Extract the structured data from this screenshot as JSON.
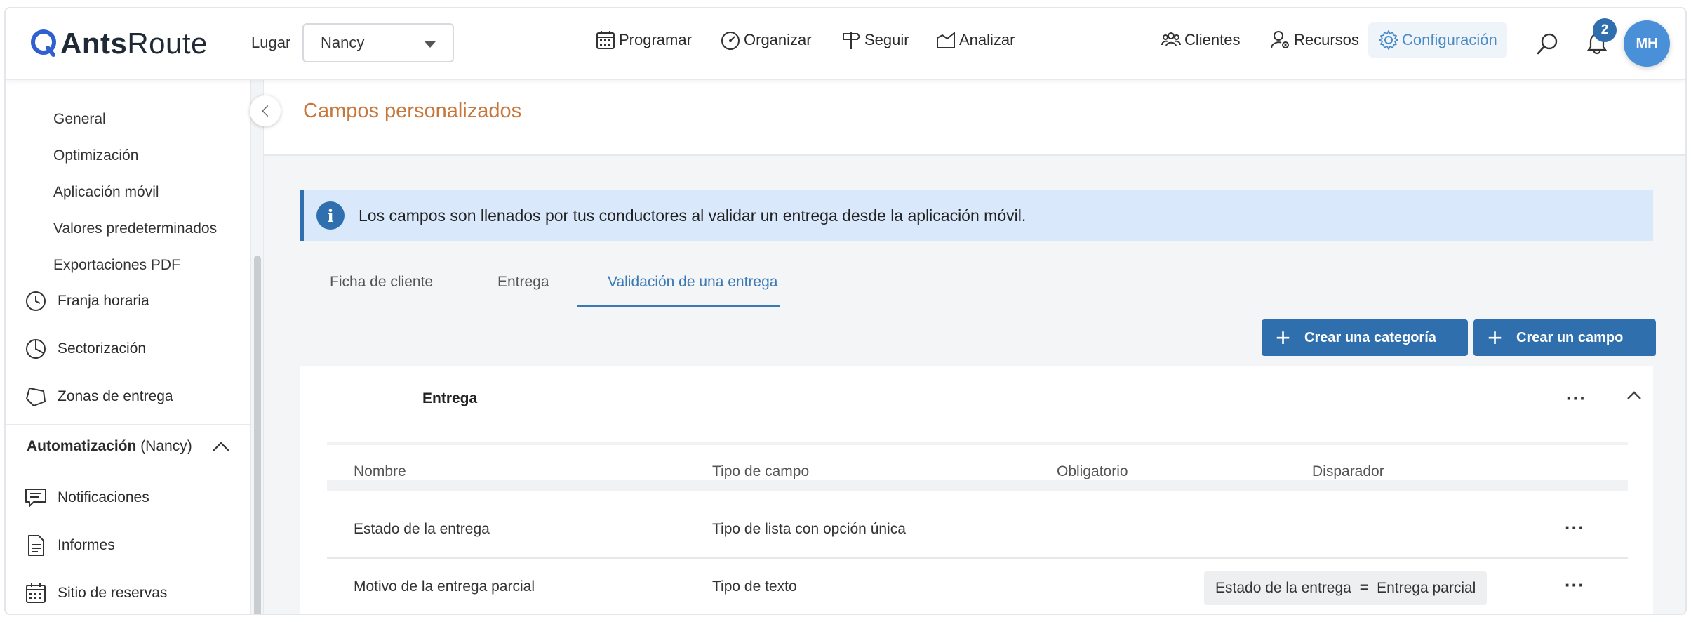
{
  "header": {
    "brand_bold": "Ants",
    "brand_light": "Route",
    "lugar_label": "Lugar",
    "lugar_value": "Nancy",
    "nav": {
      "programar": "Programar",
      "organizar": "Organizar",
      "seguir": "Seguir",
      "analizar": "Analizar",
      "clientes": "Clientes",
      "recursos": "Recursos",
      "configuracion": "Configuración"
    },
    "notifications_count": "2",
    "avatar_initials": "MH"
  },
  "sidebar": {
    "sub_items": [
      "General",
      "Optimización",
      "Aplicación móvil",
      "Valores predeterminados",
      "Exportaciones PDF"
    ],
    "items": {
      "franja": "Franja horaria",
      "sectorizacion": "Sectorización",
      "zonas": "Zonas de entrega"
    },
    "section_bold": "Automatización",
    "section_rest": "(Nancy)",
    "section_items": {
      "notificaciones": "Notificaciones",
      "informes": "Informes",
      "sitio": "Sitio de reservas"
    }
  },
  "main": {
    "title": "Campos personalizados",
    "info": "Los campos son llenados por tus conductores al validar un entrega desde la aplicación móvil.",
    "tabs": [
      "Ficha de cliente",
      "Entrega",
      "Validación de una entrega"
    ],
    "buttons": {
      "create_category": "Crear una categoría",
      "create_field": "Crear un campo"
    },
    "card": {
      "title": "Entrega",
      "columns": [
        "Nombre",
        "Tipo de campo",
        "Obligatorio",
        "Disparador"
      ],
      "rows": [
        {
          "nombre": "Estado de la entrega",
          "tipo": "Tipo de lista con opción única",
          "obligatorio": "",
          "trigger_field": "",
          "trigger_op": "",
          "trigger_value": ""
        },
        {
          "nombre": "Motivo de la entrega parcial",
          "tipo": "Tipo de texto",
          "obligatorio": "",
          "trigger_field": "Estado de la entrega",
          "trigger_op": "=",
          "trigger_value": "Entrega parcial"
        }
      ]
    }
  },
  "colors": {
    "primary": "#2f6fad",
    "title_accent": "#c7773c",
    "info_bg": "#d9e8fb",
    "config_active": "#4a8bc4"
  }
}
